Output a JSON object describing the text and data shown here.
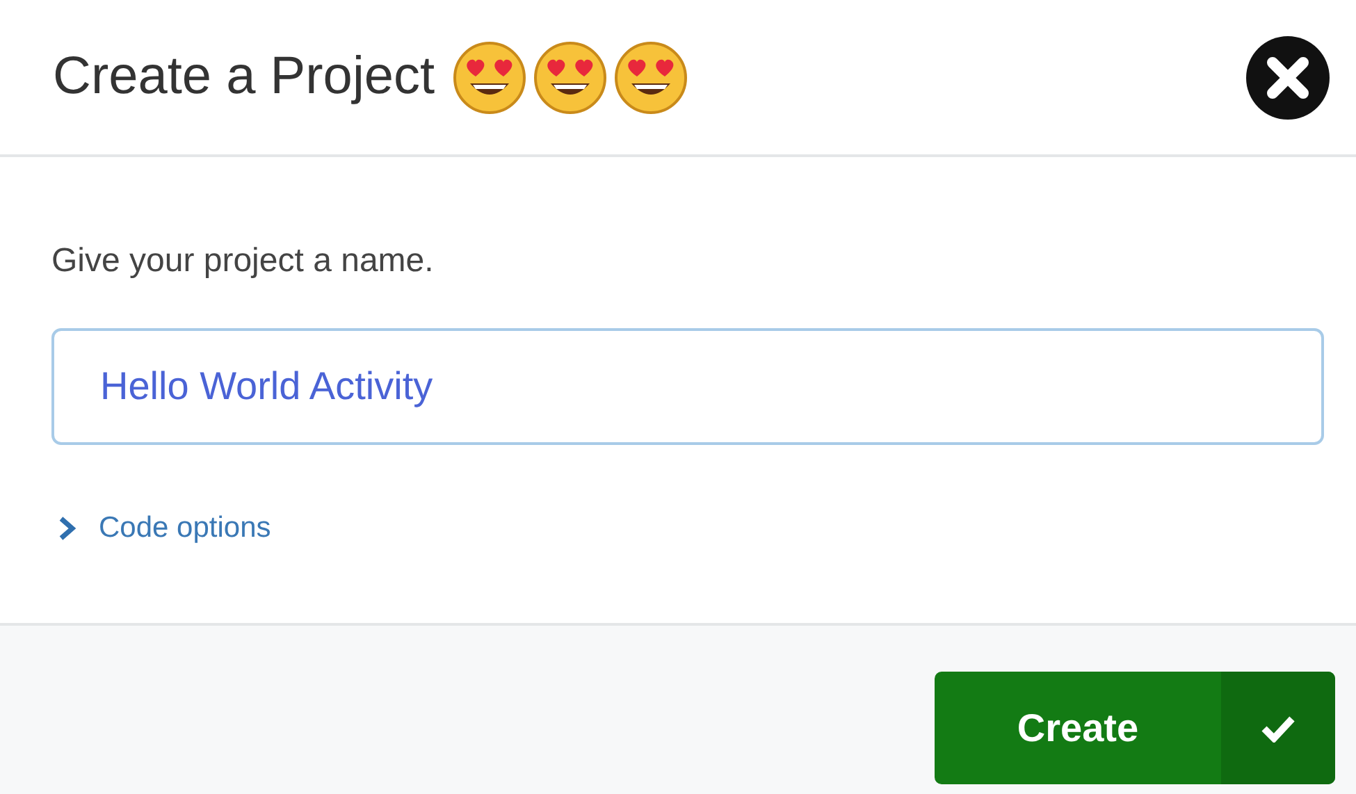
{
  "dialog": {
    "title": "Create a Project"
  },
  "name_field": {
    "label": "Give your project a name.",
    "value": "Hello World Activity",
    "focused": true
  },
  "code_options": {
    "label": "Code options",
    "expanded": false
  },
  "buttons": [
    {
      "label": "Create",
      "kind": "primary"
    }
  ]
}
